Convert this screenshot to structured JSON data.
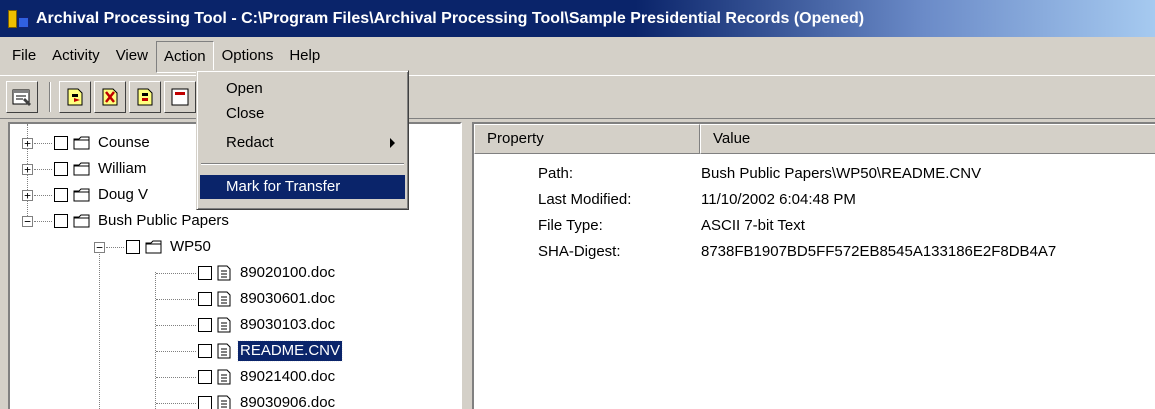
{
  "window": {
    "title": "Archival Processing Tool - C:\\Program Files\\Archival Processing Tool\\Sample Presidential Records (Opened)"
  },
  "menubar": {
    "items": [
      "File",
      "Activity",
      "View",
      "Action",
      "Options",
      "Help"
    ],
    "open_menu": "Action"
  },
  "action_menu": {
    "items": [
      {
        "label": "Open"
      },
      {
        "label": "Close"
      },
      {
        "label": "Redact",
        "submenu": true
      },
      {
        "label": "Mark for Transfer",
        "highlighted": true
      }
    ]
  },
  "toolbar": {
    "buttons": [
      "properties-icon",
      "add-record-icon",
      "remove-record-icon",
      "mark-record-icon",
      "report-icon"
    ]
  },
  "tree": {
    "nodes": [
      {
        "label": "Counse",
        "type": "folder",
        "expanded": false
      },
      {
        "label": "William",
        "type": "folder",
        "expanded": false
      },
      {
        "label": "Doug V",
        "type": "folder",
        "expanded": false
      },
      {
        "label": "Bush Public Papers",
        "type": "folder",
        "expanded": true
      },
      {
        "label": "WP50",
        "type": "folder",
        "expanded": true
      },
      {
        "label": "89020100.doc",
        "type": "file"
      },
      {
        "label": "89030601.doc",
        "type": "file"
      },
      {
        "label": "89030103.doc",
        "type": "file"
      },
      {
        "label": "README.CNV",
        "type": "file",
        "selected": true
      },
      {
        "label": "89021400.doc",
        "type": "file"
      },
      {
        "label": "89030906.doc",
        "type": "file"
      }
    ]
  },
  "properties": {
    "headers": [
      "Property",
      "Value"
    ],
    "rows": [
      {
        "name": "Path:",
        "value": "Bush Public Papers\\WP50\\README.CNV"
      },
      {
        "name": "Last Modified:",
        "value": "11/10/2002 6:04:48 PM"
      },
      {
        "name": "File Type:",
        "value": "ASCII 7-bit Text"
      },
      {
        "name": "SHA-Digest:",
        "value": "8738FB1907BD5FF572EB8545A133186E2F8DB4A7"
      }
    ]
  },
  "colors": {
    "titlebar": "#0a246a",
    "selection": "#0a246a",
    "face": "#d4d0c8"
  }
}
